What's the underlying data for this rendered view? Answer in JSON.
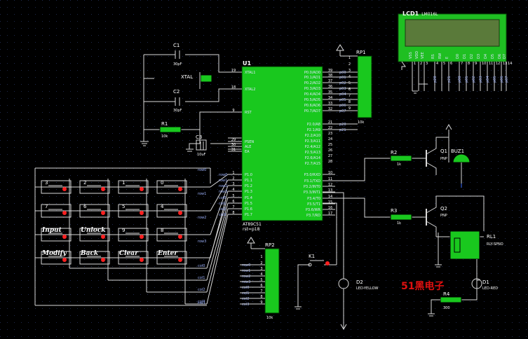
{
  "lcd": {
    "ref": "LCD1",
    "part": "LM016L",
    "pins": [
      "VSS",
      "VDD",
      "VEE",
      "RS",
      "RW",
      "E",
      "D0",
      "D1",
      "D2",
      "D3",
      "D4",
      "D5",
      "D6",
      "D7"
    ],
    "pin_nums": [
      "1",
      "2",
      "3",
      "4",
      "5",
      "6",
      "7",
      "8",
      "9",
      "10",
      "11",
      "12",
      "13",
      "14"
    ]
  },
  "mcu": {
    "ref": "U1",
    "part": "AT89C51",
    "sub": "rst=p18",
    "left_pins": [
      "XTAL1",
      "XTAL2",
      "RST",
      "PSEN",
      "ALE",
      "EA",
      "P1.0",
      "P1.1",
      "P1.2",
      "P1.3",
      "P1.4",
      "P1.5",
      "P1.6",
      "P1.7"
    ],
    "left_nums": [
      "19",
      "18",
      "9",
      "29",
      "30",
      "31",
      "1",
      "2",
      "3",
      "4",
      "5",
      "6",
      "7",
      "8"
    ],
    "right_top": [
      "P0.0/AD0",
      "P0.1/AD1",
      "P0.2/AD2",
      "P0.3/AD3",
      "P0.4/AD4",
      "P0.5/AD5",
      "P0.6/AD6",
      "P0.7/AD7"
    ],
    "right_top_nums": [
      "39",
      "38",
      "37",
      "36",
      "35",
      "34",
      "33",
      "32"
    ],
    "right_mid": [
      "P2.0/A8",
      "P2.1/A9",
      "P2.2/A10",
      "P2.3/A11",
      "P2.4/A12",
      "P2.5/A13",
      "P2.6/A14",
      "P2.7/A15"
    ],
    "right_mid_nums": [
      "21",
      "22",
      "23",
      "24",
      "25",
      "26",
      "27",
      "28"
    ],
    "right_bot": [
      "P3.0/RXD",
      "P3.1/TXD",
      "P3.2/INT0",
      "P3.3/INT1",
      "P3.4/T0",
      "P3.5/T1",
      "P3.6/WR",
      "P3.7/RD"
    ],
    "right_bot_nums": [
      "10",
      "11",
      "12",
      "13",
      "14",
      "15",
      "16",
      "17"
    ]
  },
  "p0_nets": [
    "p00",
    "p01",
    "p02",
    "p03",
    "p04",
    "p05",
    "p06",
    "p07"
  ],
  "p2_nets": [
    "p20",
    "p21"
  ],
  "row_nets": [
    "row0",
    "row1",
    "row2",
    "row3",
    "col0",
    "col1",
    "col2",
    "col3"
  ],
  "comp": {
    "c1": "C1",
    "c1v": "30pF",
    "c2": "C2",
    "c2v": "30pF",
    "xtal": "XTAL",
    "c3": "C3",
    "c3v": "10uF",
    "r1": "R1",
    "r1v": "10k",
    "rp1": "RP1",
    "rp1v": "10k",
    "rp2": "RP2",
    "rp2v": "10k",
    "r2": "R2",
    "r2v": "1k",
    "r3": "R3",
    "r3v": "1k",
    "q1": "Q1",
    "q1t": "PNP",
    "q2": "Q2",
    "q2t": "PNP",
    "buz": "BUZ1",
    "rl": "RL1",
    "rlv": "RLY-SPNO",
    "d1": "D1",
    "d1v": "LED-RED",
    "d2": "D2",
    "d2v": "LED-YELLOW",
    "r4": "R4",
    "r4v": "300",
    "k1": "K1"
  },
  "rp2_nets": [
    "row0",
    "row1",
    "row2",
    "row3",
    "col0",
    "col1",
    "col2",
    "col3"
  ],
  "rp2_nums": [
    "2",
    "3",
    "4",
    "5",
    "6",
    "7",
    "8",
    "9",
    "1"
  ],
  "rp1_nums": [
    "1",
    "2",
    "3",
    "4",
    "5",
    "6",
    "7",
    "8",
    "9"
  ],
  "keys": [
    [
      "3",
      "2",
      "1",
      "0"
    ],
    [
      "7",
      "6",
      "5",
      "4"
    ],
    [
      "Input",
      "Unlock",
      "9",
      "8"
    ],
    [
      "Modify",
      "Back",
      "Clear",
      "Enter"
    ]
  ],
  "col_labels": [
    "col0",
    "col1",
    "col2",
    "col3"
  ],
  "watermark": "51黑电子"
}
